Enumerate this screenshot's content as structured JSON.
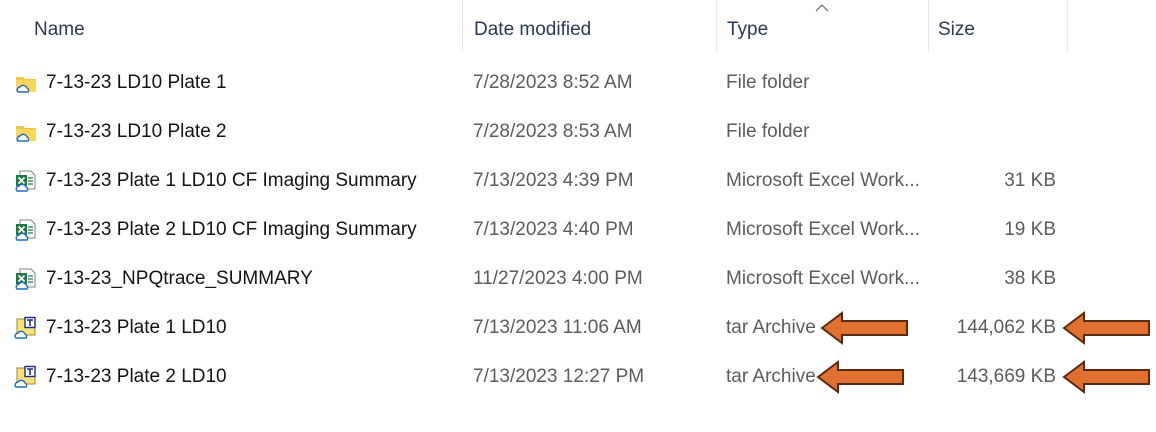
{
  "header": {
    "name_label": "Name",
    "date_label": "Date modified",
    "type_label": "Type",
    "size_label": "Size",
    "sort_icon": "chevron-up-icon"
  },
  "files": [
    {
      "name": "7-13-23 LD10 Plate 1",
      "date": "7/28/2023 8:52 AM",
      "type": "File folder",
      "size": "",
      "icon": "folder-cloud-icon"
    },
    {
      "name": "7-13-23 LD10 Plate 2",
      "date": "7/28/2023 8:53 AM",
      "type": "File folder",
      "size": "",
      "icon": "folder-cloud-icon"
    },
    {
      "name": "7-13-23 Plate 1 LD10 CF Imaging Summary",
      "date": "7/13/2023 4:39 PM",
      "type": "Microsoft Excel Work...",
      "size": "31 KB",
      "icon": "excel-cloud-icon"
    },
    {
      "name": "7-13-23 Plate 2 LD10 CF Imaging Summary",
      "date": "7/13/2023 4:40 PM",
      "type": "Microsoft Excel Work...",
      "size": "19 KB",
      "icon": "excel-cloud-icon"
    },
    {
      "name": "7-13-23_NPQtrace_SUMMARY",
      "date": "11/27/2023 4:00 PM",
      "type": "Microsoft Excel Work...",
      "size": "38 KB",
      "icon": "excel-cloud-icon"
    },
    {
      "name": "7-13-23 Plate 1 LD10",
      "date": "7/13/2023 11:06 AM",
      "type": "tar Archive",
      "size": "144,062 KB",
      "icon": "archive-cloud-icon"
    },
    {
      "name": "7-13-23 Plate 2 LD10",
      "date": "7/13/2023 12:27 PM",
      "type": "tar Archive",
      "size": "143,669 KB",
      "icon": "archive-cloud-icon"
    }
  ],
  "annotations": {
    "arrow_color": "#e07030",
    "arrow_outline": "#5a2a10"
  }
}
